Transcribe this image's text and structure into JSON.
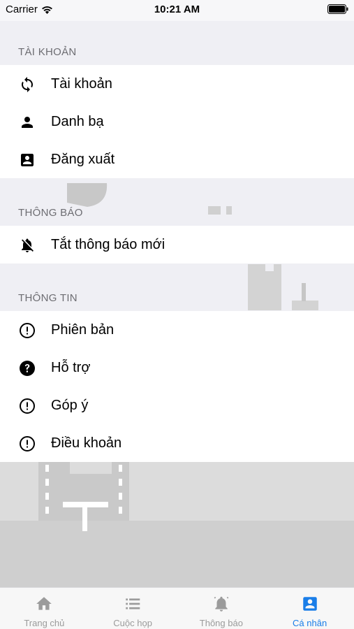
{
  "status_bar": {
    "carrier": "Carrier",
    "time": "10:21 AM"
  },
  "sections": {
    "account": {
      "header": "TÀI KHOẢN",
      "items": [
        {
          "label": "Tài khoản",
          "icon": "sync-icon"
        },
        {
          "label": "Danh bạ",
          "icon": "person-icon"
        },
        {
          "label": "Đăng xuất",
          "icon": "contact-card-icon"
        }
      ]
    },
    "notifications": {
      "header": "THÔNG BÁO",
      "items": [
        {
          "label": "Tắt thông báo mới",
          "icon": "bell-off-icon"
        }
      ]
    },
    "info": {
      "header": "THÔNG TIN",
      "items": [
        {
          "label": "Phiên bản",
          "icon": "info-circle-icon"
        },
        {
          "label": "Hỗ trợ",
          "icon": "help-circle-icon"
        },
        {
          "label": "Góp ý",
          "icon": "info-circle-icon"
        },
        {
          "label": "Điều khoản",
          "icon": "info-circle-icon"
        }
      ]
    }
  },
  "tab_bar": {
    "active": "personal",
    "tabs": [
      {
        "id": "home",
        "label": "Trang chủ",
        "icon": "home-icon"
      },
      {
        "id": "meetings",
        "label": "Cuộc họp",
        "icon": "list-icon"
      },
      {
        "id": "notifications",
        "label": "Thông báo",
        "icon": "bell-icon"
      },
      {
        "id": "personal",
        "label": "Cá nhân",
        "icon": "account-box-icon"
      }
    ]
  },
  "colors": {
    "accent": "#1a7ee8",
    "inactive_tab": "#9b9b9b",
    "section_header": "#6d6d72",
    "background": "#efeff4"
  }
}
